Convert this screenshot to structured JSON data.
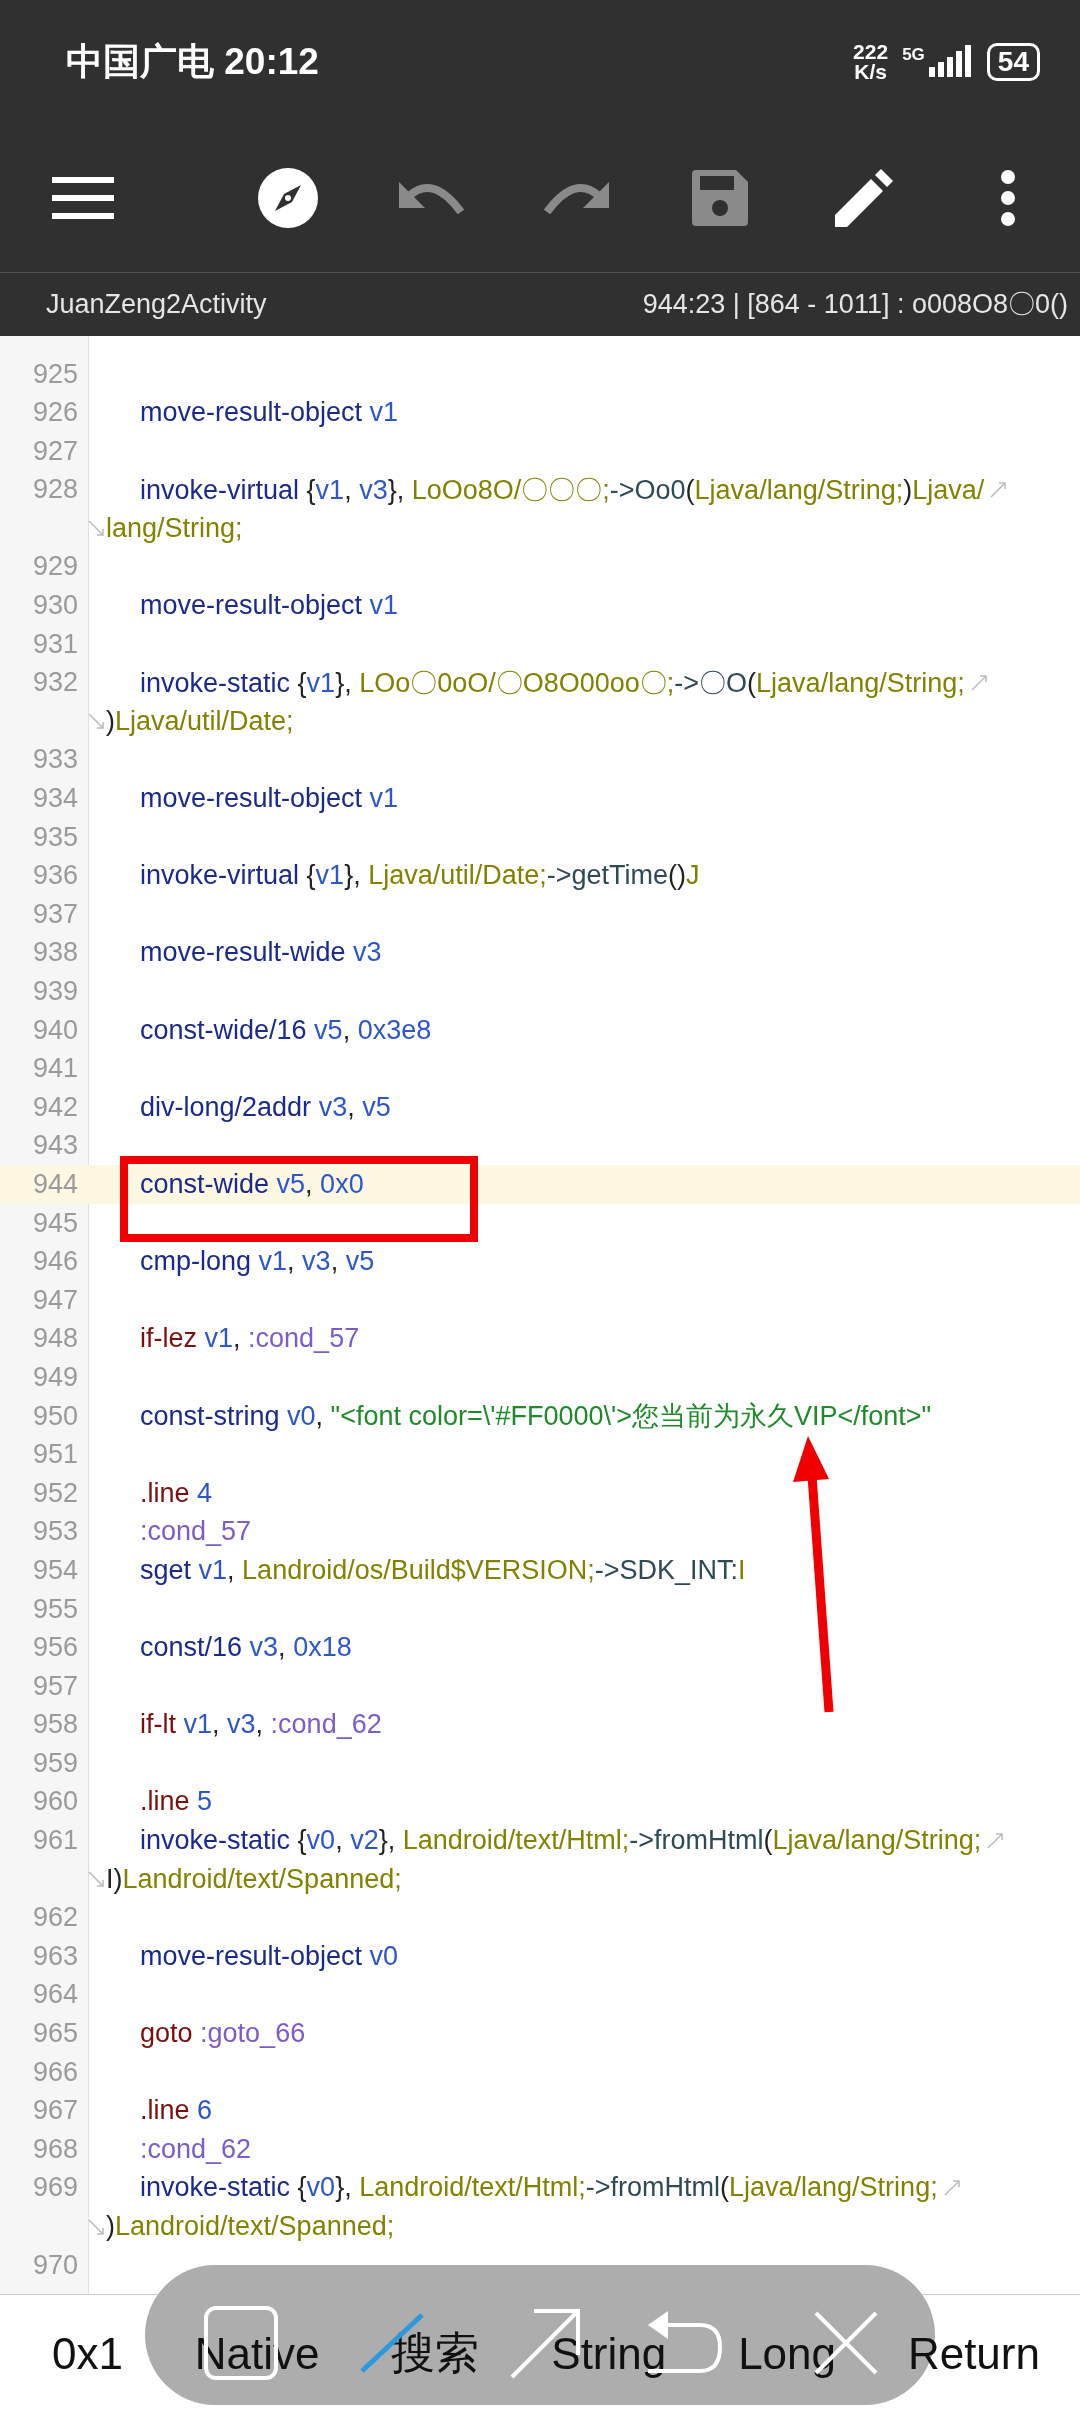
{
  "status_bar": {
    "carrier_time": "中国广电 20:12",
    "speed_value": "222",
    "speed_unit": "K/s",
    "network": "5G",
    "battery": "54"
  },
  "toolbar": [
    {
      "kind": "menu",
      "disabled": false
    },
    {
      "kind": "compass",
      "disabled": false
    },
    {
      "kind": "undo",
      "disabled": true
    },
    {
      "kind": "redo",
      "disabled": true
    },
    {
      "kind": "save",
      "disabled": true
    },
    {
      "kind": "edit",
      "disabled": false
    },
    {
      "kind": "more",
      "disabled": false
    }
  ],
  "subtitle": {
    "class_name": "JuanZeng2Activity",
    "position": "944:23 | [864 - 1011] : o008O8〇0()"
  },
  "lines": [
    {
      "number": "925",
      "current": false
    },
    {
      "number": "926",
      "current": false,
      "tokens": [
        {
          "text": "move-result-object",
          "kind": "op"
        },
        {
          "text": " v1",
          "kind": "reg"
        }
      ]
    },
    {
      "number": "927",
      "current": false
    },
    {
      "number": "928",
      "current": false,
      "tokens": [
        {
          "text": "invoke-virtual",
          "kind": "op"
        },
        {
          "text": " {",
          "kind": "punct"
        },
        {
          "text": "v1",
          "kind": "reg"
        },
        {
          "text": ", ",
          "kind": "punct"
        },
        {
          "text": "v3",
          "kind": "reg"
        },
        {
          "text": "}, ",
          "kind": "punct"
        },
        {
          "text": "LoOo8O/〇〇〇;",
          "kind": "type"
        },
        {
          "text": "->Oo0",
          "kind": "method"
        },
        {
          "text": "(",
          "kind": "punct"
        },
        {
          "text": "Ljava/lang/String;",
          "kind": "type"
        },
        {
          "text": ")",
          "kind": "punct"
        },
        {
          "text": "Ljava/",
          "kind": "type"
        }
      ],
      "wrap": [
        {
          "text": "lang/String;",
          "kind": "type"
        }
      ]
    },
    {
      "number": "929",
      "current": false
    },
    {
      "number": "930",
      "current": false,
      "tokens": [
        {
          "text": "move-result-object",
          "kind": "op"
        },
        {
          "text": " v1",
          "kind": "reg"
        }
      ]
    },
    {
      "number": "931",
      "current": false
    },
    {
      "number": "932",
      "current": false,
      "tokens": [
        {
          "text": "invoke-static",
          "kind": "op"
        },
        {
          "text": " {",
          "kind": "punct"
        },
        {
          "text": "v1",
          "kind": "reg"
        },
        {
          "text": "}, ",
          "kind": "punct"
        },
        {
          "text": "LOo〇0oO/〇O8O00oo〇;",
          "kind": "type"
        },
        {
          "text": "->〇O",
          "kind": "method"
        },
        {
          "text": "(",
          "kind": "punct"
        },
        {
          "text": "Ljava/lang/String;",
          "kind": "type"
        }
      ],
      "wrap": [
        {
          "text": ")",
          "kind": "punct"
        },
        {
          "text": "Ljava/util/Date;",
          "kind": "type"
        }
      ]
    },
    {
      "number": "933",
      "current": false
    },
    {
      "number": "934",
      "current": false,
      "tokens": [
        {
          "text": "move-result-object",
          "kind": "op"
        },
        {
          "text": " v1",
          "kind": "reg"
        }
      ]
    },
    {
      "number": "935",
      "current": false
    },
    {
      "number": "936",
      "current": false,
      "tokens": [
        {
          "text": "invoke-virtual",
          "kind": "op"
        },
        {
          "text": " {",
          "kind": "punct"
        },
        {
          "text": "v1",
          "kind": "reg"
        },
        {
          "text": "}, ",
          "kind": "punct"
        },
        {
          "text": "Ljava/util/Date;",
          "kind": "type"
        },
        {
          "text": "->getTime",
          "kind": "method"
        },
        {
          "text": "()",
          "kind": "punct"
        },
        {
          "text": "J",
          "kind": "type"
        }
      ]
    },
    {
      "number": "937",
      "current": false
    },
    {
      "number": "938",
      "current": false,
      "tokens": [
        {
          "text": "move-result-wide",
          "kind": "op"
        },
        {
          "text": " v3",
          "kind": "reg"
        }
      ]
    },
    {
      "number": "939",
      "current": false
    },
    {
      "number": "940",
      "current": false,
      "tokens": [
        {
          "text": "const-wide/16",
          "kind": "op"
        },
        {
          "text": " v5",
          "kind": "reg"
        },
        {
          "text": ", ",
          "kind": "punct"
        },
        {
          "text": "0x3e8",
          "kind": "reg"
        }
      ]
    },
    {
      "number": "941",
      "current": false
    },
    {
      "number": "942",
      "current": false,
      "tokens": [
        {
          "text": "div-long/2addr",
          "kind": "op"
        },
        {
          "text": " v3",
          "kind": "reg"
        },
        {
          "text": ", ",
          "kind": "punct"
        },
        {
          "text": "v5",
          "kind": "reg"
        }
      ]
    },
    {
      "number": "943",
      "current": false
    },
    {
      "number": "944",
      "current": true,
      "tokens": [
        {
          "text": "const-wide",
          "kind": "op"
        },
        {
          "text": " v5",
          "kind": "reg"
        },
        {
          "text": ", ",
          "kind": "punct"
        },
        {
          "text": "0x0",
          "kind": "reg"
        }
      ]
    },
    {
      "number": "945",
      "current": false
    },
    {
      "number": "946",
      "current": false,
      "tokens": [
        {
          "text": "cmp-long",
          "kind": "op"
        },
        {
          "text": " v1",
          "kind": "reg"
        },
        {
          "text": ", ",
          "kind": "punct"
        },
        {
          "text": "v3",
          "kind": "reg"
        },
        {
          "text": ", ",
          "kind": "punct"
        },
        {
          "text": "v5",
          "kind": "reg"
        }
      ]
    },
    {
      "number": "947",
      "current": false
    },
    {
      "number": "948",
      "current": false,
      "tokens": [
        {
          "text": "if-lez",
          "kind": "directive"
        },
        {
          "text": " v1",
          "kind": "reg"
        },
        {
          "text": ", ",
          "kind": "punct"
        },
        {
          "text": ":cond_57",
          "kind": "label"
        }
      ]
    },
    {
      "number": "949",
      "current": false
    },
    {
      "number": "950",
      "current": false,
      "tokens": [
        {
          "text": "const-string",
          "kind": "op"
        },
        {
          "text": " v0",
          "kind": "reg"
        },
        {
          "text": ", ",
          "kind": "punct"
        },
        {
          "text": "\"<font color=\\'#FF0000\\'>您当前为永久VIP</font>\"",
          "kind": "str"
        }
      ]
    },
    {
      "number": "951",
      "current": false
    },
    {
      "number": "952",
      "current": false,
      "tokens": [
        {
          "text": ".line",
          "kind": "directive"
        },
        {
          "text": " 4",
          "kind": "reg"
        }
      ]
    },
    {
      "number": "953",
      "current": false,
      "tokens": [
        {
          "text": ":cond_57",
          "kind": "label"
        }
      ]
    },
    {
      "number": "954",
      "current": false,
      "tokens": [
        {
          "text": "sget",
          "kind": "op"
        },
        {
          "text": " v1",
          "kind": "reg"
        },
        {
          "text": ", ",
          "kind": "punct"
        },
        {
          "text": "Landroid/os/Build$VERSION;",
          "kind": "type"
        },
        {
          "text": "->SDK_INT:",
          "kind": "method"
        },
        {
          "text": "I",
          "kind": "type"
        }
      ]
    },
    {
      "number": "955",
      "current": false
    },
    {
      "number": "956",
      "current": false,
      "tokens": [
        {
          "text": "const/16",
          "kind": "op"
        },
        {
          "text": " v3",
          "kind": "reg"
        },
        {
          "text": ", ",
          "kind": "punct"
        },
        {
          "text": "0x18",
          "kind": "reg"
        }
      ]
    },
    {
      "number": "957",
      "current": false
    },
    {
      "number": "958",
      "current": false,
      "tokens": [
        {
          "text": "if-lt",
          "kind": "directive"
        },
        {
          "text": " v1",
          "kind": "reg"
        },
        {
          "text": ", ",
          "kind": "punct"
        },
        {
          "text": "v3",
          "kind": "reg"
        },
        {
          "text": ", ",
          "kind": "punct"
        },
        {
          "text": ":cond_62",
          "kind": "label"
        }
      ]
    },
    {
      "number": "959",
      "current": false
    },
    {
      "number": "960",
      "current": false,
      "tokens": [
        {
          "text": ".line",
          "kind": "directive"
        },
        {
          "text": " 5",
          "kind": "reg"
        }
      ]
    },
    {
      "number": "961",
      "current": false,
      "tokens": [
        {
          "text": "invoke-static",
          "kind": "op"
        },
        {
          "text": " {",
          "kind": "punct"
        },
        {
          "text": "v0",
          "kind": "reg"
        },
        {
          "text": ", ",
          "kind": "punct"
        },
        {
          "text": "v2",
          "kind": "reg"
        },
        {
          "text": "}, ",
          "kind": "punct"
        },
        {
          "text": "Landroid/text/Html;",
          "kind": "type"
        },
        {
          "text": "->fromHtml",
          "kind": "method"
        },
        {
          "text": "(",
          "kind": "punct"
        },
        {
          "text": "Ljava/lang/String;",
          "kind": "type"
        }
      ],
      "wrap": [
        {
          "text": "I)",
          "kind": "punct"
        },
        {
          "text": "Landroid/text/Spanned;",
          "kind": "type"
        }
      ]
    },
    {
      "number": "962",
      "current": false
    },
    {
      "number": "963",
      "current": false,
      "tokens": [
        {
          "text": "move-result-object",
          "kind": "op"
        },
        {
          "text": " v0",
          "kind": "reg"
        }
      ]
    },
    {
      "number": "964",
      "current": false
    },
    {
      "number": "965",
      "current": false,
      "tokens": [
        {
          "text": "goto",
          "kind": "directive"
        },
        {
          "text": " :goto_66",
          "kind": "label"
        }
      ]
    },
    {
      "number": "966",
      "current": false
    },
    {
      "number": "967",
      "current": false,
      "tokens": [
        {
          "text": ".line",
          "kind": "directive"
        },
        {
          "text": " 6",
          "kind": "reg"
        }
      ]
    },
    {
      "number": "968",
      "current": false,
      "tokens": [
        {
          "text": ":cond_62",
          "kind": "label"
        }
      ]
    },
    {
      "number": "969",
      "current": false,
      "tokens": [
        {
          "text": "invoke-static",
          "kind": "op"
        },
        {
          "text": " {",
          "kind": "punct"
        },
        {
          "text": "v0",
          "kind": "reg"
        },
        {
          "text": "}, ",
          "kind": "punct"
        },
        {
          "text": "Landroid/text/Html;",
          "kind": "type"
        },
        {
          "text": "->fromHtml",
          "kind": "method"
        },
        {
          "text": "(",
          "kind": "punct"
        },
        {
          "text": "Ljava/lang/String;",
          "kind": "type"
        }
      ],
      "wrap": [
        {
          "text": ")",
          "kind": "punct"
        },
        {
          "text": "Landroid/text/Spanned;",
          "kind": "type"
        }
      ]
    },
    {
      "number": "970",
      "current": false
    }
  ],
  "bottom_keys": [
    "0x1",
    "Native",
    "搜索",
    "String",
    "Long",
    "Return"
  ],
  "floating_toolbar": [
    {
      "kind": "square"
    },
    {
      "kind": "slash"
    },
    {
      "kind": "arrow"
    },
    {
      "kind": "return"
    },
    {
      "kind": "close"
    }
  ]
}
